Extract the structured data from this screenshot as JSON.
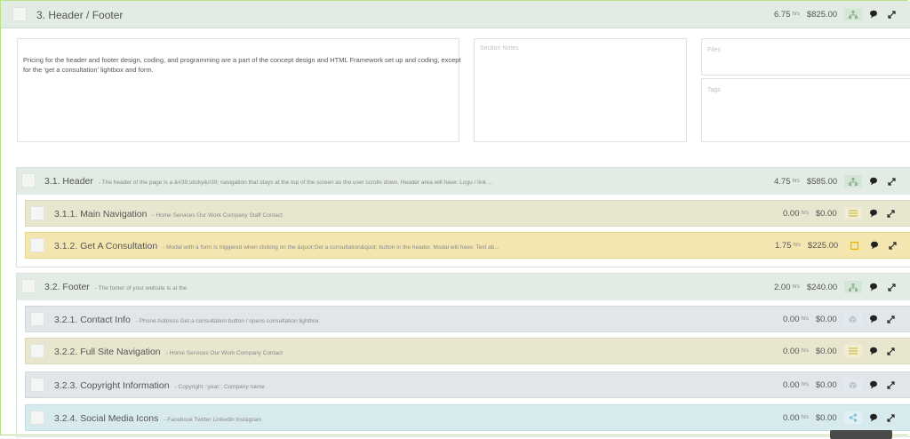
{
  "section": {
    "title": "3. Header / Footer",
    "hrs": "6.75",
    "hrs_unit": "hrs",
    "price": "$825.00",
    "description": "Pricing for the header and footer design, coding, and programming are a part of the concept design and HTML Framework set up and coding, except for the 'get a consultation' lightbox and form.",
    "notes_placeholder": "Section Notes",
    "files_placeholder": "Files",
    "tags_placeholder": "Tags"
  },
  "groups": [
    {
      "title": "3.1. Header",
      "desc": "- The header of the page is a &#39;sticky&#39; navigation that stays at the top of the screen as the user scrolls down. Header area will have: Logo / link ...",
      "hrs": "4.75",
      "price": "$585.00",
      "items": [
        {
          "title": "3.1.1. Main Navigation",
          "desc": "- Home Services Our Work Company Staff Contact",
          "hrs": "0.00",
          "price": "$0.00"
        },
        {
          "title": "3.1.2. Get A Consultation",
          "desc": "- Modal with a form is triggered when clicking on the &quot;Get a consultation&quot; button in the header. Modal will have: Text ab...",
          "hrs": "1.75",
          "price": "$225.00"
        }
      ]
    },
    {
      "title": "3.2. Footer",
      "desc": "- The footer of your website is at the",
      "hrs": "2.00",
      "price": "$240.00",
      "items": [
        {
          "title": "3.2.1. Contact Info",
          "desc": "- Phone Address Get a consultation button / opens consultation lightbox",
          "hrs": "0.00",
          "price": "$0.00"
        },
        {
          "title": "3.2.2. Full Site Navigation",
          "desc": "- Home Services Our Work Company Contact",
          "hrs": "0.00",
          "price": "$0.00"
        },
        {
          "title": "3.2.3. Copyright Information",
          "desc": "- Copyright ::year:: Company name",
          "hrs": "0.00",
          "price": "$0.00"
        },
        {
          "title": "3.2.4. Social Media Icons",
          "desc": "- Facebook Twitter Linkedin Instagram",
          "hrs": "0.00",
          "price": "$0.00"
        }
      ]
    }
  ],
  "colors": {
    "section_bg": "#e2ebe4",
    "tan_row": "#e9e6d0",
    "yellow_row": "#f4e6b0",
    "gray_row": "#e1e6ea",
    "blue_row": "#d7eaee",
    "accent_green": "#9ccf5a"
  }
}
